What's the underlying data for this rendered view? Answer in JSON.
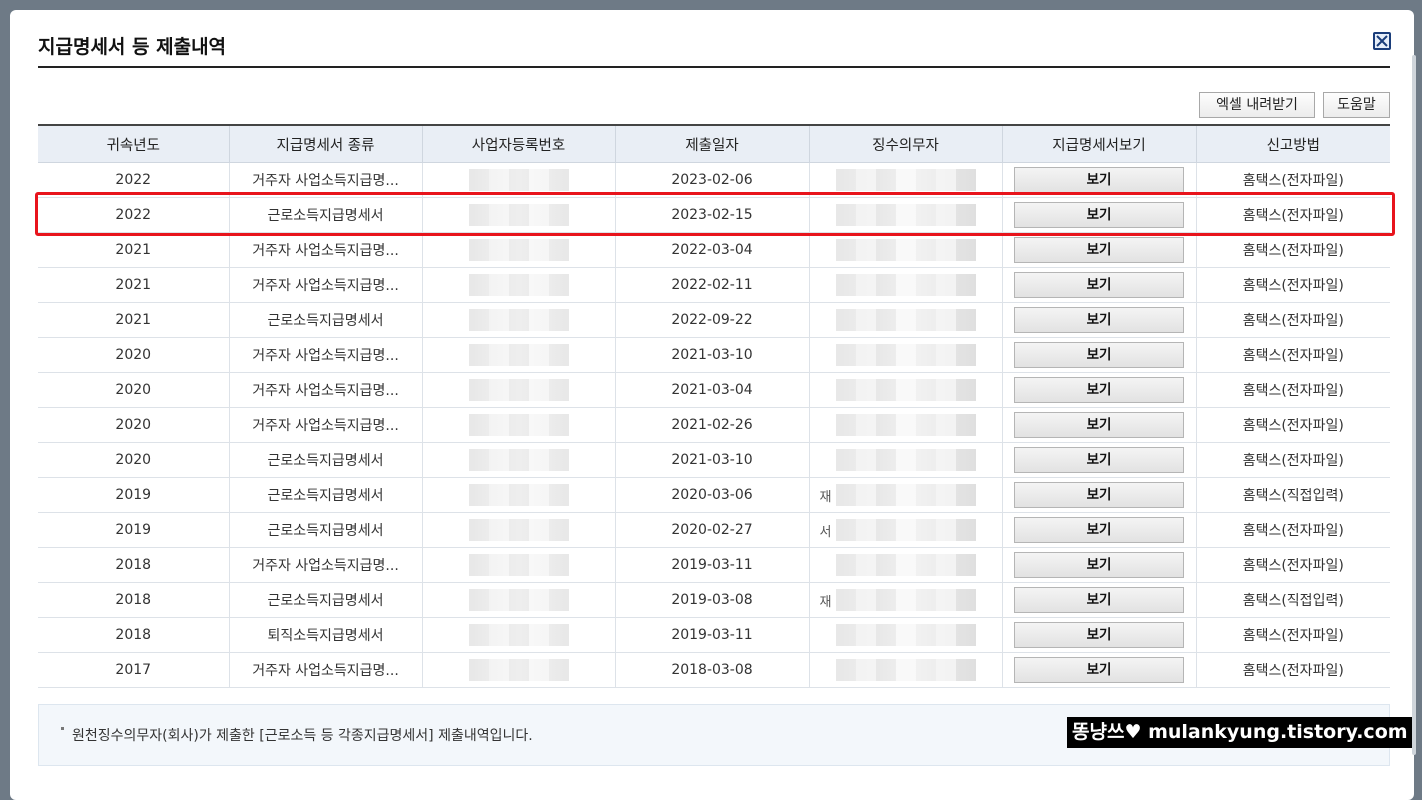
{
  "modal": {
    "title": "지급명세서 등 제출내역",
    "close_label": "닫기"
  },
  "toolbar": {
    "excel_label": "엑셀 내려받기",
    "help_label": "도움말"
  },
  "table": {
    "headers": [
      "귀속년도",
      "지급명세서 종류",
      "사업자등록번호",
      "제출일자",
      "징수의무자",
      "지급명세서보기",
      "신고방법"
    ],
    "view_label": "보기",
    "rows": [
      {
        "year": "2022",
        "kind": "거주자 사업소득지급명...",
        "biz_no": "",
        "date": "2023-02-06",
        "payer": "",
        "method": "홈택스(전자파일)"
      },
      {
        "year": "2022",
        "kind": "근로소득지급명세서",
        "biz_no": "",
        "date": "2023-02-15",
        "payer": "",
        "method": "홈택스(전자파일)"
      },
      {
        "year": "2021",
        "kind": "거주자 사업소득지급명...",
        "biz_no": "",
        "date": "2022-03-04",
        "payer": "",
        "method": "홈택스(전자파일)"
      },
      {
        "year": "2021",
        "kind": "거주자 사업소득지급명...",
        "biz_no": "",
        "date": "2022-02-11",
        "payer": "",
        "method": "홈택스(전자파일)"
      },
      {
        "year": "2021",
        "kind": "근로소득지급명세서",
        "biz_no": "",
        "date": "2022-09-22",
        "payer": "",
        "method": "홈택스(전자파일)"
      },
      {
        "year": "2020",
        "kind": "거주자 사업소득지급명...",
        "biz_no": "",
        "date": "2021-03-10",
        "payer": "",
        "method": "홈택스(전자파일)"
      },
      {
        "year": "2020",
        "kind": "거주자 사업소득지급명...",
        "biz_no": "",
        "date": "2021-03-04",
        "payer": "",
        "method": "홈택스(전자파일)"
      },
      {
        "year": "2020",
        "kind": "거주자 사업소득지급명...",
        "biz_no": "",
        "date": "2021-02-26",
        "payer": "",
        "method": "홈택스(전자파일)"
      },
      {
        "year": "2020",
        "kind": "근로소득지급명세서",
        "biz_no": "",
        "date": "2021-03-10",
        "payer": "",
        "method": "홈택스(전자파일)"
      },
      {
        "year": "2019",
        "kind": "근로소득지급명세서",
        "biz_no": "",
        "date": "2020-03-06",
        "payer": "재",
        "method": "홈택스(직접입력)"
      },
      {
        "year": "2019",
        "kind": "근로소득지급명세서",
        "biz_no": "",
        "date": "2020-02-27",
        "payer": "서",
        "method": "홈택스(전자파일)"
      },
      {
        "year": "2018",
        "kind": "거주자 사업소득지급명...",
        "biz_no": "",
        "date": "2019-03-11",
        "payer": "",
        "method": "홈택스(전자파일)"
      },
      {
        "year": "2018",
        "kind": "근로소득지급명세서",
        "biz_no": "",
        "date": "2019-03-08",
        "payer": "재",
        "method": "홈택스(직접입력)"
      },
      {
        "year": "2018",
        "kind": "퇴직소득지급명세서",
        "biz_no": "",
        "date": "2019-03-11",
        "payer": "",
        "method": "홈택스(전자파일)"
      },
      {
        "year": "2017",
        "kind": "거주자 사업소득지급명...",
        "biz_no": "",
        "date": "2018-03-08",
        "payer": "",
        "method": "홈택스(전자파일)"
      }
    ]
  },
  "notice": "원천징수의무자(회사)가 제출한 [근로소득 등 각종지급명세서] 제출내역입니다.",
  "watermark": "똥냥쓰♥ mulankyung.tistory.com",
  "colors": {
    "highlight": "#e8141c",
    "header_bg": "#e9eef5",
    "close_icon": "#1a3d7a"
  }
}
